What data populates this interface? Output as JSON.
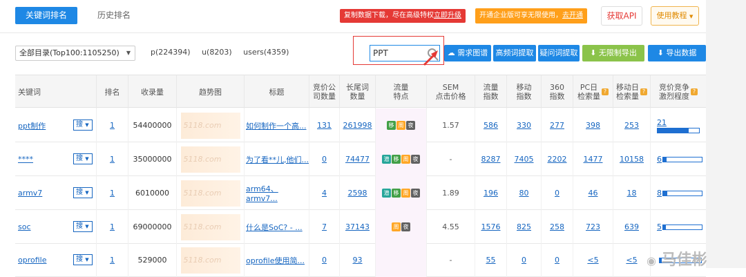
{
  "tabs": {
    "active": "关键词排名",
    "other": "历史排名"
  },
  "promos": {
    "copy_text": "复制数据下载，尽在高级特权",
    "copy_link": "立即升级",
    "enterprise_text": "开通企业版可享无限使用，",
    "enterprise_link": "去开通"
  },
  "top_buttons": {
    "api": "获取API",
    "tutorial": "使用教程"
  },
  "filter": {
    "directory": "全部目录(Top100:1105250)",
    "p": "p(224394)",
    "u": "u(8203)",
    "users": "users(4359)",
    "search_value": "PPT"
  },
  "action_buttons": {
    "demand": "需求图谱",
    "high_freq": "高频词提取",
    "question": "疑问词提取",
    "unlimited": "无限制导出",
    "export": "导出数据"
  },
  "columns": [
    "关键词",
    "排名",
    "收录量",
    "趋势图",
    "标题",
    "竞价公\n司数量",
    "长尾词\n数量",
    "流量\n特点",
    "SEM\n点击价格",
    "流量\n指数",
    "移动\n指数",
    "360\n指数",
    "PC日\n检索量",
    "移动日\n检索量",
    "竞价竞争\n激烈程度"
  ],
  "trend_watermark": "5118.com",
  "search_label": "搜",
  "rows": [
    {
      "keyword": "ppt制作",
      "rank": "1",
      "indexed": "54400000",
      "title": "如何制作一个高...",
      "bid_companies": "131",
      "long_tail": "261998",
      "tags": [
        "移",
        "周",
        "夜"
      ],
      "sem": "1.57",
      "flow": "586",
      "mobile": "330",
      "i360": "277",
      "pc_daily": "398",
      "mobile_daily": "253",
      "level": "21",
      "level_pct": 0.75,
      "level_style": "stacked"
    },
    {
      "keyword": "****",
      "rank": "1",
      "indexed": "35000000",
      "title": "为了看**儿,他们...",
      "bid_companies": "0",
      "long_tail": "74477",
      "tags": [
        "潜",
        "移",
        "周",
        "夜"
      ],
      "sem": "-",
      "flow": "8287",
      "mobile": "7405",
      "i360": "2202",
      "pc_daily": "1477",
      "mobile_daily": "10158",
      "level": "6",
      "level_pct": 0.08,
      "level_style": "inline"
    },
    {
      "keyword": "armv7",
      "rank": "1",
      "indexed": "6010000",
      "title": "arm64、armv7...",
      "bid_companies": "4",
      "long_tail": "2598",
      "tags": [
        "潜",
        "移",
        "周",
        "夜"
      ],
      "sem": "1.89",
      "flow": "196",
      "mobile": "80",
      "i360": "0",
      "pc_daily": "46",
      "mobile_daily": "18",
      "level": "8",
      "level_pct": 0.1,
      "level_style": "inline"
    },
    {
      "keyword": "soc",
      "rank": "1",
      "indexed": "69000000",
      "title": "什么是SoC? - ...",
      "bid_companies": "7",
      "long_tail": "37143",
      "tags": [
        "周",
        "夜"
      ],
      "sem": "4.55",
      "flow": "1576",
      "mobile": "825",
      "i360": "258",
      "pc_daily": "723",
      "mobile_daily": "639",
      "level": "5",
      "level_pct": 0.06,
      "level_style": "inline"
    },
    {
      "keyword": "oprofile",
      "rank": "1",
      "indexed": "529000",
      "title": "oprofile使用简...",
      "bid_companies": "0",
      "long_tail": "93",
      "tags": [],
      "sem": "-",
      "flow": "55",
      "mobile": "0",
      "i360": "0",
      "pc_daily": "<5",
      "mobile_daily": "<5",
      "level": "",
      "level_pct": 0.05,
      "level_style": "inline"
    }
  ],
  "watermark": "马佳彬",
  "colors": {
    "primary": "#1e88e5",
    "promo_red": "#e53935",
    "promo_orange": "#ff9f1a",
    "green": "#8bc34a"
  }
}
